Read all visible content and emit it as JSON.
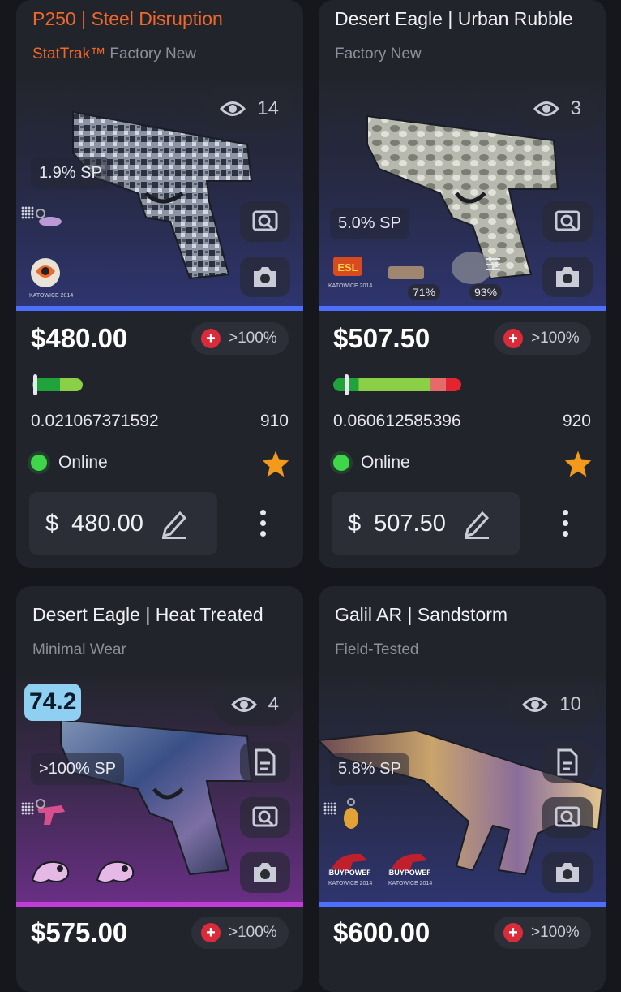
{
  "cards": [
    {
      "title": "P250 | Steel Disruption",
      "stattrak": "StatTrak™",
      "wear": "Factory New",
      "views": "14",
      "sp": "1.9% SP",
      "price": "$480.00",
      "pct": ">100%",
      "float": "0.021067371592",
      "pattern": "910",
      "status": "Online",
      "currency": "$",
      "input_value": "480.00",
      "sticker_label": "KATOWICE 2014",
      "bar_color": "#4c6fff",
      "float_fraction": 0.021
    },
    {
      "title": "Desert Eagle | Urban Rubble",
      "wear": "Factory New",
      "views": "3",
      "sp": "5.0% SP",
      "price": "$507.50",
      "pct": ">100%",
      "float": "0.060612585396",
      "pattern": "920",
      "status": "Online",
      "currency": "$",
      "input_value": "507.50",
      "sticker_label": "KATOWICE 2014",
      "sticker_wear_1": "71%",
      "sticker_wear_2": "93%",
      "bar_color": "#4c6fff",
      "float_fraction": 0.06
    },
    {
      "title": "Desert Eagle | Heat Treated",
      "wear": "Minimal Wear",
      "views": "4",
      "sp": ">100% SP",
      "float_tag": "74.2",
      "price": "$575.00",
      "pct": ">100%",
      "bar_color": "#c13bd9"
    },
    {
      "title": "Galil AR | Sandstorm",
      "wear": "Field-Tested",
      "views": "10",
      "sp": "5.8% SP",
      "price": "$600.00",
      "pct": ">100%",
      "sticker_label": "KATOWICE 2014",
      "bar_color": "#4c6fff"
    }
  ],
  "icons": {
    "eye": "eye-icon",
    "inspect": "inspect-icon",
    "camera": "camera-icon",
    "document": "document-icon",
    "pencil": "pencil-icon",
    "star": "star-icon",
    "more": "more-vertical-icon",
    "sliders": "sliders-icon"
  }
}
